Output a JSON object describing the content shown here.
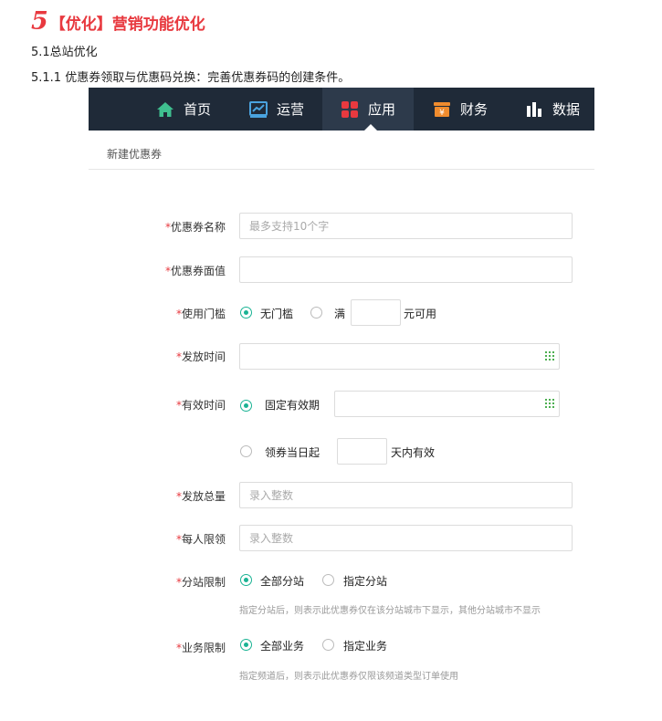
{
  "doc": {
    "section_num": "5",
    "section_title": "【优化】营销功能优化",
    "subsection": "5.1总站优化",
    "subsubsection": "5.1.1  优惠券领取与优惠码兑换：完善优惠券码的创建条件。"
  },
  "nav": {
    "items": [
      {
        "label": "首页",
        "icon": "home-icon"
      },
      {
        "label": "运营",
        "icon": "chart-icon"
      },
      {
        "label": "应用",
        "icon": "apps-icon"
      },
      {
        "label": "财务",
        "icon": "wallet-icon"
      },
      {
        "label": "数据",
        "icon": "bar-chart-icon"
      }
    ],
    "active_index": 2
  },
  "page": {
    "title": "新建优惠券"
  },
  "form": {
    "required_mark": "*",
    "coupon_name": {
      "label": "优惠券名称",
      "placeholder": "最多支持10个字"
    },
    "coupon_value": {
      "label": "优惠券面值",
      "placeholder": ""
    },
    "threshold": {
      "label": "使用门槛",
      "option_none": "无门槛",
      "option_full": "满",
      "suffix": "元可用"
    },
    "issue_time": {
      "label": "发放时间"
    },
    "valid_time": {
      "label": "有效时间",
      "option_fixed": "固定有效期",
      "option_relative": "领券当日起",
      "relative_suffix": "天内有效"
    },
    "total": {
      "label": "发放总量",
      "placeholder": "录入整数"
    },
    "per_person": {
      "label": "每人限领",
      "placeholder": "录入整数"
    },
    "branch_limit": {
      "label": "分站限制",
      "option_all": "全部分站",
      "option_specific": "指定分站",
      "hint": "指定分站后，则表示此优惠券仅在该分站城市下显示，其他分站城市不显示"
    },
    "business_limit": {
      "label": "业务限制",
      "option_all": "全部业务",
      "option_specific": "指定业务",
      "hint": "指定频道后，则表示此优惠券仅限该频道类型订单使用"
    }
  },
  "colors": {
    "nav_bg": "#1f2a38",
    "accent": "#1ab394",
    "required": "#e8393f"
  }
}
